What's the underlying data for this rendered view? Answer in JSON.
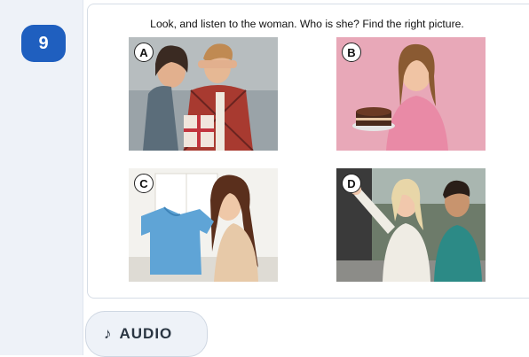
{
  "question": {
    "number": "9",
    "instruction": "Look, and listen to the woman. Who is she? Find the right picture."
  },
  "options": [
    {
      "letter": "A",
      "icon": "couple-with-gift-image"
    },
    {
      "letter": "B",
      "icon": "woman-with-cake-image"
    },
    {
      "letter": "C",
      "icon": "woman-with-blue-shirt-image"
    },
    {
      "letter": "D",
      "icon": "woman-pointing-man-image"
    }
  ],
  "audio": {
    "icon": "♪",
    "label": "AUDIO"
  }
}
